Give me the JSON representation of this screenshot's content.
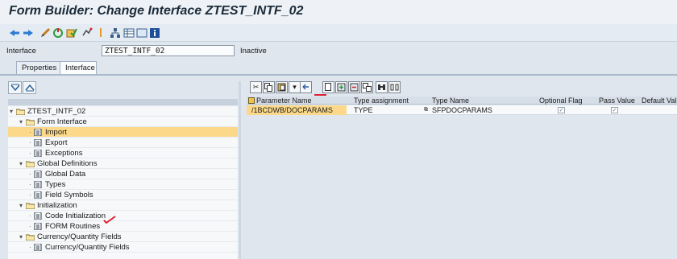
{
  "window": {
    "title": "Form Builder: Change Interface ZTEST_INTF_02"
  },
  "toolbar": {
    "icons": [
      "back-icon",
      "forward-icon",
      "edit-toggle-icon",
      "activate-icon",
      "check-icon",
      "where-used-icon",
      "info-separator-icon",
      "hierarchy-icon",
      "table-icon",
      "layout-icon",
      "help-info-icon"
    ]
  },
  "interface": {
    "label": "Interface",
    "value": "ZTEST_INTF_02",
    "status": "Inactive"
  },
  "tabs": [
    {
      "label": "Properties",
      "active": false
    },
    {
      "label": "Interface",
      "active": true
    }
  ],
  "tree": {
    "nodes": [
      {
        "label": "ZTEST_INTF_02",
        "type": "folder",
        "level": 0
      },
      {
        "label": "Form Interface",
        "type": "folder",
        "level": 1
      },
      {
        "label": "Import",
        "type": "doc",
        "level": 2,
        "selected": true
      },
      {
        "label": "Export",
        "type": "doc",
        "level": 2
      },
      {
        "label": "Exceptions",
        "type": "doc",
        "level": 2
      },
      {
        "label": "Global Definitions",
        "type": "folder",
        "level": 1
      },
      {
        "label": "Global Data",
        "type": "doc",
        "level": 2
      },
      {
        "label": "Types",
        "type": "doc",
        "level": 2
      },
      {
        "label": "Field Symbols",
        "type": "doc",
        "level": 2
      },
      {
        "label": "Initialization",
        "type": "folder",
        "level": 1
      },
      {
        "label": "Code Initialization",
        "type": "doc",
        "level": 2
      },
      {
        "label": "FORM Routines",
        "type": "doc",
        "level": 2
      },
      {
        "label": "Currency/Quantity Fields",
        "type": "folder",
        "level": 1
      },
      {
        "label": "Currency/Quantity Fields",
        "type": "doc",
        "level": 2
      }
    ]
  },
  "grid": {
    "columns": [
      "Parameter Name",
      "Type assignment",
      "Type Name",
      "Optional Flag",
      "Pass Value",
      "Default Val"
    ],
    "rows": [
      {
        "param": "/1BCDWB/DOCPARAMS",
        "assign": "TYPE",
        "typename": "SFPDOCPARAMS",
        "optional": "✓",
        "pass": "✓",
        "default": ""
      }
    ]
  },
  "colors": {
    "selected": "#fcd98a",
    "accent": "#d23"
  }
}
